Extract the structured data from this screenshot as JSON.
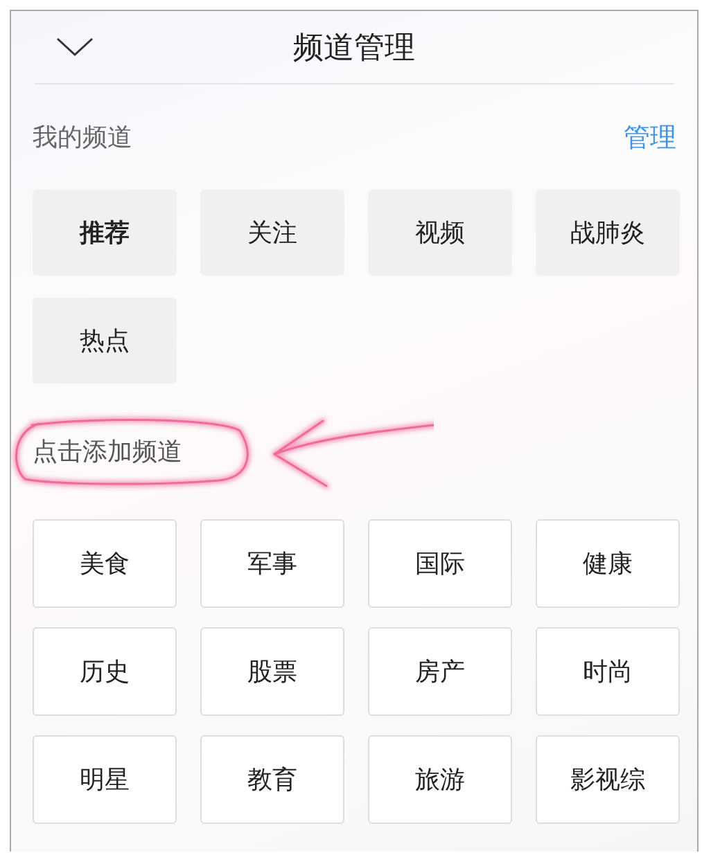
{
  "header": {
    "title": "频道管理"
  },
  "my_channels": {
    "title": "我的频道",
    "action": "管理",
    "items": [
      {
        "label": "推荐",
        "selected": true
      },
      {
        "label": "关注",
        "selected": false
      },
      {
        "label": "视频",
        "selected": false
      },
      {
        "label": "战肺炎",
        "selected": false
      },
      {
        "label": "热点",
        "selected": false
      }
    ]
  },
  "add_channels": {
    "title": "点击添加频道",
    "items": [
      "美食",
      "军事",
      "国际",
      "健康",
      "历史",
      "股票",
      "房产",
      "时尚",
      "明星",
      "教育",
      "旅游",
      "影视综"
    ]
  }
}
